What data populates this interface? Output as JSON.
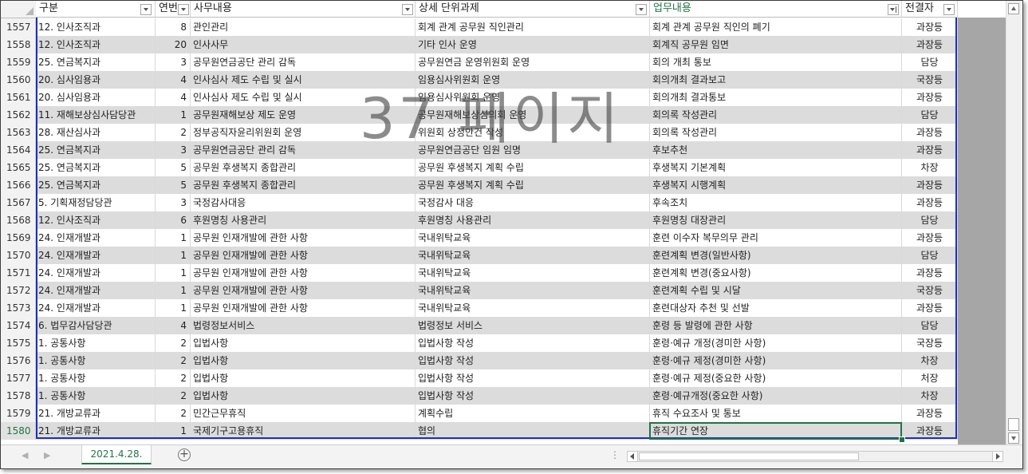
{
  "headers": [
    "구분",
    "연번",
    "사무내용",
    "상세 단위과제",
    "업무내용",
    "전결자"
  ],
  "watermark": "37 페이지",
  "rows": [
    {
      "num": "1557",
      "c1": "12. 인사조직과",
      "c2": "8",
      "c3": "관인관리",
      "c4": "회계 관계 공무원 직인관리",
      "c5": "회계 관계 공무원 직인의 폐기",
      "c6": "과장등"
    },
    {
      "num": "1558",
      "c1": "12. 인사조직과",
      "c2": "20",
      "c3": "인사사무",
      "c4": "기타 인사 운영",
      "c5": "회계직 공무원 임면",
      "c6": "과장등"
    },
    {
      "num": "1559",
      "c1": "25. 연금복지과",
      "c2": "3",
      "c3": "공무원연금공단 관리 감독",
      "c4": "공무원연금 운영위원회 운영",
      "c5": "회의 개최 통보",
      "c6": "담당"
    },
    {
      "num": "1560",
      "c1": "20. 심사임용과",
      "c2": "4",
      "c3": "인사심사 제도 수립 및 실시",
      "c4": "임용심사위원회 운영",
      "c5": "회의개최 결과보고",
      "c6": "국장등"
    },
    {
      "num": "1561",
      "c1": "20. 심사임용과",
      "c2": "4",
      "c3": "인사심사 제도 수립 및 실시",
      "c4": "임용심사위원회 운영",
      "c5": "회의개최 결과통보",
      "c6": "과장등"
    },
    {
      "num": "1562",
      "c1": "11. 재해보상심사담당관",
      "c2": "1",
      "c3": "공무원재해보상 제도 운영",
      "c4": "공무원재해보상심의회 운영",
      "c5": "회의록 작성관리",
      "c6": "담당"
    },
    {
      "num": "1563",
      "c1": "28. 재산심사과",
      "c2": "2",
      "c3": "정부공직자윤리위원회 운영",
      "c4": "위원회 상정안건 작성",
      "c5": "회의록 작성관리",
      "c6": "과장등"
    },
    {
      "num": "1564",
      "c1": "25. 연금복지과",
      "c2": "3",
      "c3": "공무원연금공단 관리 감독",
      "c4": "공무원연금공단 임원 임명",
      "c5": "후보추천",
      "c6": "과장등"
    },
    {
      "num": "1565",
      "c1": "25. 연금복지과",
      "c2": "5",
      "c3": "공무원 후생복지 종합관리",
      "c4": "공무원 후생복지 계획 수립",
      "c5": "후생복지 기본계획",
      "c6": "차장"
    },
    {
      "num": "1566",
      "c1": "25. 연금복지과",
      "c2": "5",
      "c3": "공무원 후생복지 종합관리",
      "c4": "공무원 후생복지 계획 수립",
      "c5": "후생복지 시행계획",
      "c6": "과장등"
    },
    {
      "num": "1567",
      "c1": "5. 기획재정담당관",
      "c2": "3",
      "c3": "국정감사대응",
      "c4": "국정감사 대응",
      "c5": "후속조치",
      "c6": "과장등"
    },
    {
      "num": "1568",
      "c1": "12. 인사조직과",
      "c2": "6",
      "c3": "후원명칭 사용관리",
      "c4": "후원명칭 사용관리",
      "c5": "후원명칭 대장관리",
      "c6": "담당"
    },
    {
      "num": "1569",
      "c1": "24. 인재개발과",
      "c2": "1",
      "c3": "공무원 인재개발에 관한 사항",
      "c4": "국내위탁교육",
      "c5": "훈련 이수자 복무의무 관리",
      "c6": "과장등"
    },
    {
      "num": "1570",
      "c1": "24. 인재개발과",
      "c2": "1",
      "c3": "공무원 인재개발에 관한 사항",
      "c4": "국내위탁교육",
      "c5": "훈련계획 변경(일반사항)",
      "c6": "담당"
    },
    {
      "num": "1571",
      "c1": "24. 인재개발과",
      "c2": "1",
      "c3": "공무원 인재개발에 관한 사항",
      "c4": "국내위탁교육",
      "c5": "훈련계획 변경(중요사항)",
      "c6": "과장등"
    },
    {
      "num": "1572",
      "c1": "24. 인재개발과",
      "c2": "1",
      "c3": "공무원 인재개발에 관한 사항",
      "c4": "국내위탁교육",
      "c5": "훈련계획 수립 및 시달",
      "c6": "국장등"
    },
    {
      "num": "1573",
      "c1": "24. 인재개발과",
      "c2": "1",
      "c3": "공무원 인재개발에 관한 사항",
      "c4": "국내위탁교육",
      "c5": "훈련대상자 추천 및 선발",
      "c6": "과장등"
    },
    {
      "num": "1574",
      "c1": "6. 법무감사담당관",
      "c2": "4",
      "c3": "법령정보서비스",
      "c4": "법령정보 서비스",
      "c5": "훈령 등 발령에 관한 사항",
      "c6": "담당"
    },
    {
      "num": "1575",
      "c1": "1. 공통사항",
      "c2": "2",
      "c3": "입법사항",
      "c4": "입법사항 작성",
      "c5": "훈령·예규 개정(경미한 사항)",
      "c6": "국장등"
    },
    {
      "num": "1576",
      "c1": "1. 공통사항",
      "c2": "2",
      "c3": "입법사항",
      "c4": "입법사항 작성",
      "c5": "훈령·예규 제정(경미한 사항)",
      "c6": "차장"
    },
    {
      "num": "1577",
      "c1": "1. 공통사항",
      "c2": "2",
      "c3": "입법사항",
      "c4": "입법사항 작성",
      "c5": "훈령·예규 제정(중요한 사항)",
      "c6": "처장"
    },
    {
      "num": "1578",
      "c1": "1. 공통사항",
      "c2": "2",
      "c3": "입법사항",
      "c4": "입법사항 작성",
      "c5": "훈령·예규개정(중요한 사항)",
      "c6": "차장"
    },
    {
      "num": "1579",
      "c1": "21. 개방교류과",
      "c2": "2",
      "c3": "민간근무휴직",
      "c4": "계획수립",
      "c5": "휴직 수요조사 및 통보",
      "c6": "과장등"
    },
    {
      "num": "1580",
      "c1": "21. 개방교류과",
      "c2": "1",
      "c3": "국제기구고용휴직",
      "c4": "협의",
      "c5": "휴직기간 연장",
      "c6": "과장등"
    }
  ],
  "sheet_tab": "2021.4.28.",
  "colors": {
    "band_a": "#ffffff",
    "band_b": "#dcdcdc",
    "accent_green": "#217346",
    "outline_blue": "#1f2fbd",
    "gray_area": "#a6a6a6"
  }
}
